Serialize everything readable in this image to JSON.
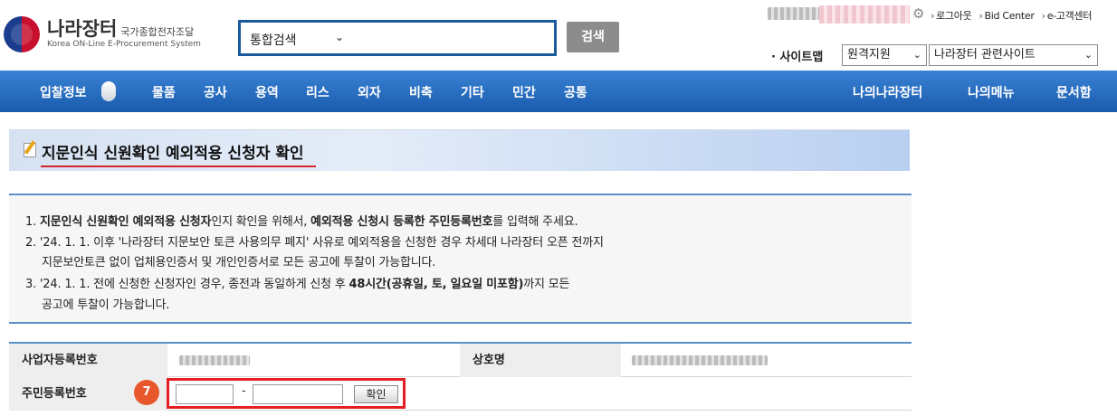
{
  "logo": {
    "title": "나라장터",
    "title_small": "국가종합전자조달",
    "subtitle": "Korea ON-Line E-Procurement System"
  },
  "search": {
    "scope": "통합검색",
    "button": "검색"
  },
  "top_links": [
    "로그아웃",
    "Bid Center",
    "e-고객센터"
  ],
  "sitemap": {
    "label": "· 사이트맵",
    "select1": "원격지원",
    "select2": "나라장터 관련사이트"
  },
  "nav": {
    "left": [
      "입찰정보",
      "물품",
      "공사",
      "용역",
      "리스",
      "외자",
      "비축",
      "기타",
      "민간",
      "공통"
    ],
    "right": [
      "나의나라장터",
      "나의메뉴",
      "문서함"
    ]
  },
  "page_title": "지문인식 신원확인 예외적용 신청자 확인",
  "notice": {
    "l1_a": "1. ",
    "l1_b": "지문인식 신원확인 예외적용 신청자",
    "l1_c": "인지 확인을 위해서, ",
    "l1_d": "예외적용 신청시 등록한 주민등록번호",
    "l1_e": "를 입력해 주세요.",
    "l2": "2. '24. 1. 1. 이후 '나라장터 지문보안 토큰 사용의무 폐지' 사유로 예외적용을 신청한 경우 차세대 나라장터 오픈 전까지",
    "l2b": "지문보안토큰 없이 업체용인증서 및 개인인증서로 모든 공고에 투찰이 가능합니다.",
    "l3_a": "3. '24. 1. 1. 전에 신청한 신청자인 경우, 종전과 동일하게 신청 후 ",
    "l3_b": "48시간(공휴일, 토, 일요일 미포함)",
    "l3_c": "까지 모든",
    "l3d": "공고에 투찰이 가능합니다."
  },
  "form": {
    "biz_no_label": "사업자등록번호",
    "company_label": "상호명",
    "ssn_label": "주민등록번호",
    "ssn_dash": "-",
    "confirm_button": "확인",
    "step_marker": "7"
  }
}
